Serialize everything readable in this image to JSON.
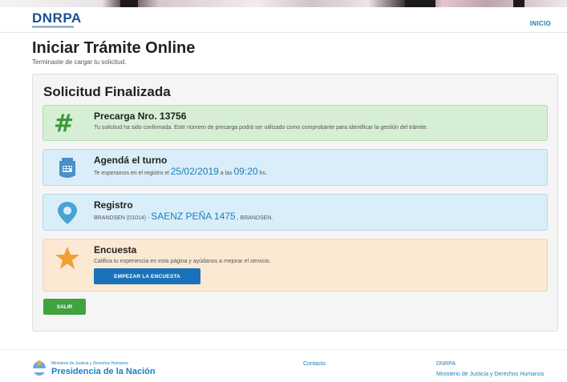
{
  "header": {
    "logo": "DNRPA",
    "nav_inicio": "INICIO"
  },
  "page": {
    "title": "Iniciar Trámite Online",
    "subtitle": "Terminaste de cargar tu solicitud."
  },
  "panel": {
    "title": "Solicitud Finalizada",
    "precarga": {
      "title": "Precarga Nro. 13756",
      "text": "Tu solicitud ha sido confirmada. Este número de precarga podrá ser utilizado como comprobante para identificar la gestión del trámite."
    },
    "turno": {
      "title": "Agendá el turno",
      "text_pre": "Te esperamos en el registro el",
      "date": "25/02/2019",
      "text_mid": "a las",
      "time": "09:20",
      "text_post": "hs."
    },
    "registro": {
      "title": "Registro",
      "text_pre": "BRANDSEN (01014) -",
      "address": "SAENZ PEÑA 1475",
      "text_post": ", BRANDSEN."
    },
    "encuesta": {
      "title": "Encuesta",
      "text": "Califica tu experiencia en esta página y ayúdanos a mejorar el servicio.",
      "button": "EMPEZAR LA ENCUESTA"
    },
    "salir_button": "SALIR"
  },
  "footer": {
    "ministerio_small": "Ministerio de Justicia y Derechos Humanos",
    "presidencia": "Presidencia de la Nación",
    "contacto": "Contacto",
    "dnrpa": "DNRPA",
    "ministerio_link": "Ministerio de Justicia y Derechos Humanos"
  },
  "colors": {
    "brand_blue": "#1d4f91",
    "link_blue": "#1a7fc1",
    "success_green": "#3fa33f",
    "info_bg": "#d9eef8",
    "warning_bg": "#fbe9d4",
    "success_bg": "#d6eed3",
    "star_orange": "#f0a030"
  },
  "icons": {
    "precarga": "hash-icon",
    "turno": "calendar-tag-icon",
    "registro": "map-pin-icon",
    "encuesta": "star-icon",
    "footer": "argentina-emblem-icon"
  }
}
